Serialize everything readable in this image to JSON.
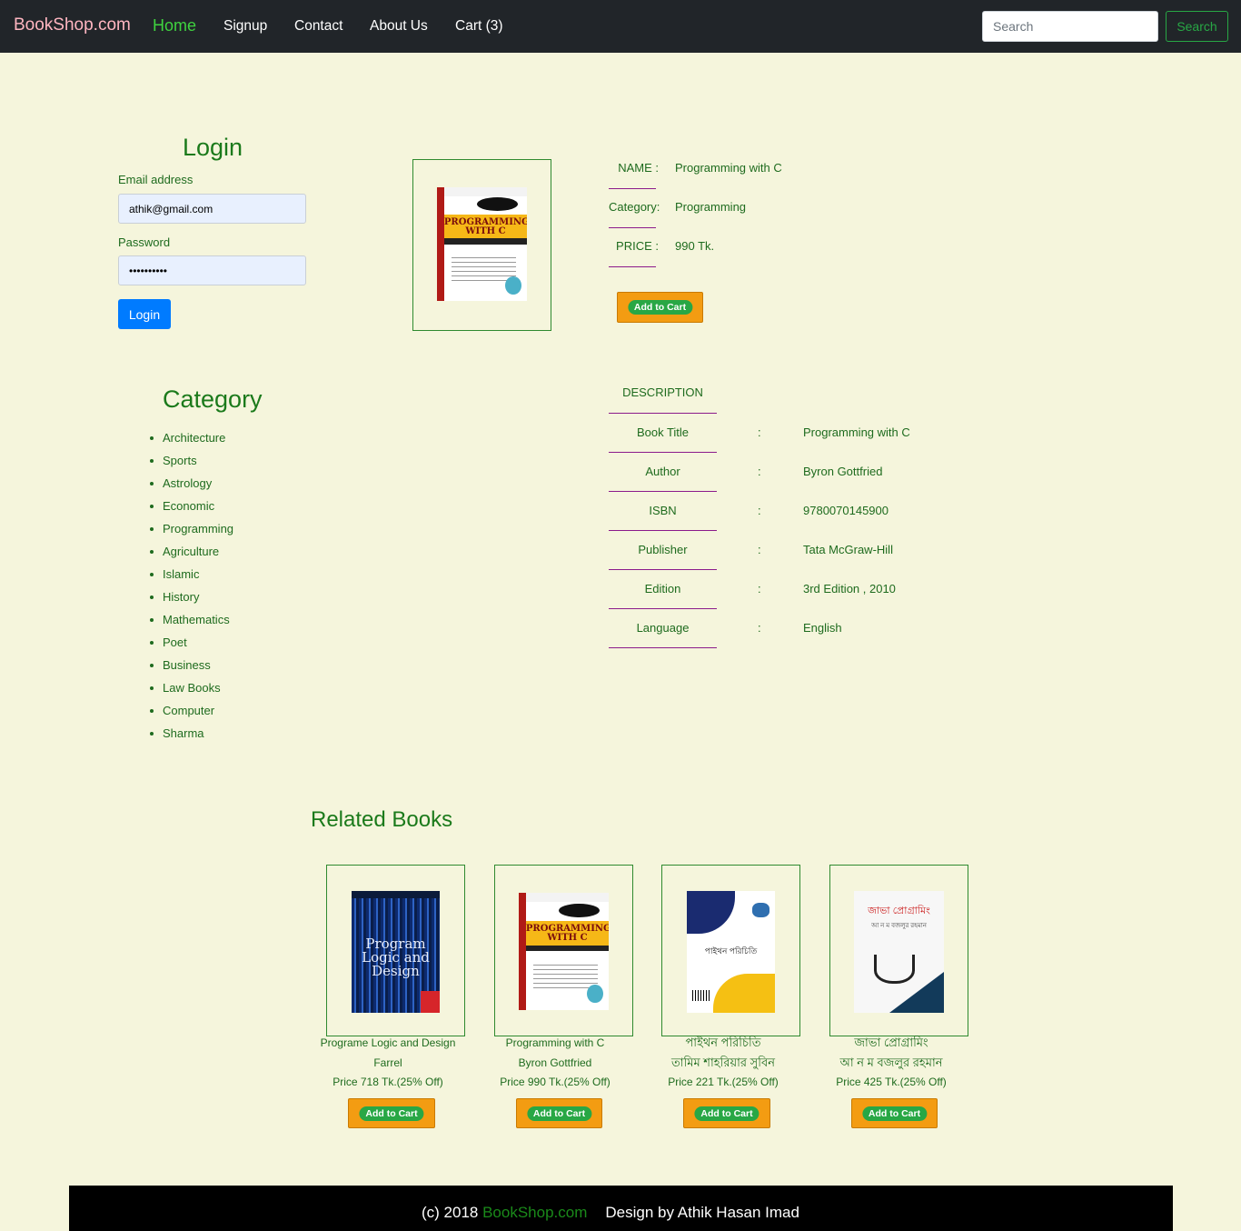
{
  "navbar": {
    "brand": "BookShop.com",
    "links": [
      "Home",
      "Signup",
      "Contact",
      "About Us",
      "Cart (3)"
    ],
    "search_placeholder": "Search",
    "search_button": "Search"
  },
  "login": {
    "title": "Login",
    "email_label": "Email address",
    "email_value": "athik@gmail.com",
    "password_label": "Password",
    "password_value": "••••••••••",
    "button": "Login"
  },
  "product": {
    "name_label": "NAME  :",
    "name_value": "Programming with C",
    "category_label": "Category:",
    "category_value": "Programming",
    "price_label": "PRICE  :",
    "price_value": "990 Tk.",
    "cart_button": "Add to Cart",
    "cover_title": "PROGRAMMING WITH C"
  },
  "category": {
    "title": "Category",
    "items": [
      "Architecture",
      "Sports",
      "Astrology",
      "Economic",
      "Programming",
      "Agriculture",
      "Islamic",
      "History",
      "Mathematics",
      "Poet",
      "Business",
      "Law Books",
      "Computer",
      "Sharma"
    ]
  },
  "description": {
    "heading": "DESCRIPTION",
    "colon": ":",
    "rows": [
      {
        "label": "Book Title",
        "value": "Programming with C"
      },
      {
        "label": "Author",
        "value": "Byron Gottfried"
      },
      {
        "label": "ISBN",
        "value": "9780070145900"
      },
      {
        "label": "Publisher",
        "value": "Tata McGraw-Hill"
      },
      {
        "label": "Edition",
        "value": "3rd Edition , 2010"
      },
      {
        "label": "Language",
        "value": "English"
      }
    ]
  },
  "related": {
    "title": "Related Books",
    "books": [
      {
        "title": "Programe Logic and Design",
        "author": "Farrel",
        "price": "Price 718 Tk.(25% Off)",
        "button": "Add to Cart",
        "cover_text": "Program Logic and Design"
      },
      {
        "title": "Programming with C",
        "author": "Byron Gottfried",
        "price": "Price 990 Tk.(25% Off)",
        "button": "Add to Cart",
        "cover_text": "PROGRAMMING WITH C"
      },
      {
        "title": "পাইথন পরিচিতি",
        "author": "তামিম শাহরিয়ার সুবিন",
        "price": "Price 221 Tk.(25% Off)",
        "button": "Add to Cart",
        "cover_text": "পাইথন পরিচিতি"
      },
      {
        "title": "জাভা প্রোগ্রামিং",
        "author": "আ ন ম বজলুর রহমান",
        "price": "Price 425 Tk.(25% Off)",
        "button": "Add to Cart",
        "cover_text": "জাভা প্রোগ্রামিং"
      }
    ]
  },
  "footer": {
    "prefix": "(c) 2018 ",
    "brand": "BookShop.com",
    "design": "Design by Athik Hasan Imad"
  },
  "colors": {
    "navbar_bg": "#212529",
    "page_bg": "#f5f5dc",
    "accent_green": "#1b7a1b",
    "cart_orange": "#f39c12",
    "login_blue": "#007bff",
    "brand_pink": "#ffb6c1"
  }
}
